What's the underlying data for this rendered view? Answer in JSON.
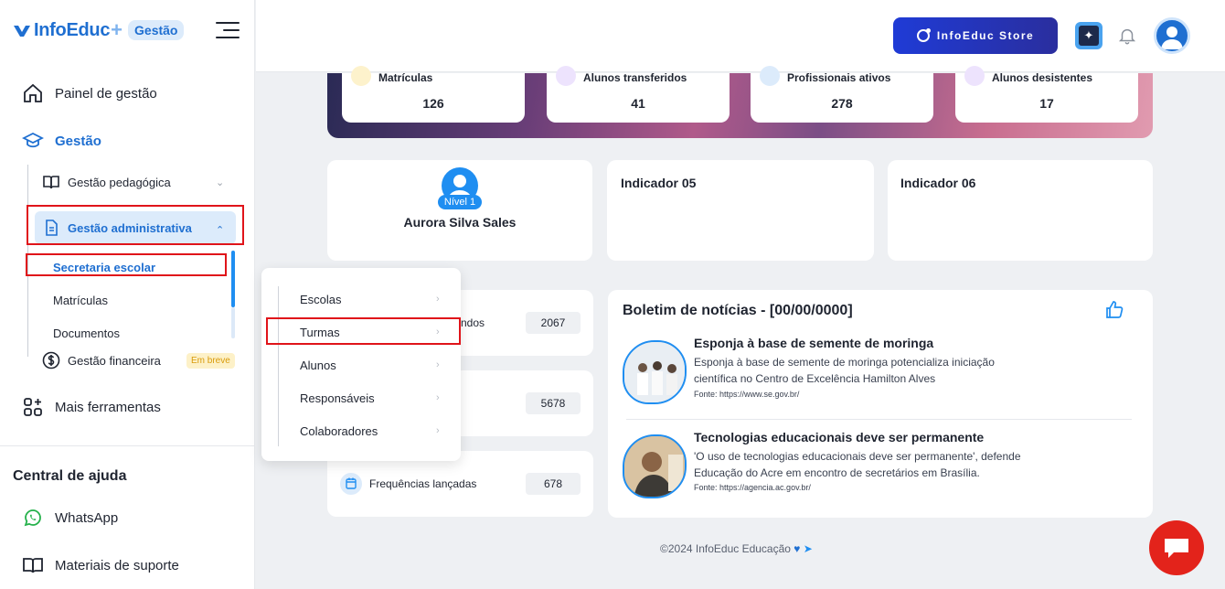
{
  "brand": {
    "name": "InfoEduc",
    "badge": "Gestão"
  },
  "sidebar": {
    "items": [
      {
        "label": "Painel de gestão"
      },
      {
        "label": "Gestão"
      },
      {
        "label": "Mais ferramentas"
      }
    ],
    "gestao_sub": {
      "pedagogica": "Gestão pedagógica",
      "administrativa": "Gestão administrativa",
      "financeira": "Gestão financeira",
      "financeira_badge": "Em breve"
    },
    "admin_sub": [
      "Secretaria escolar",
      "Matrículas",
      "Documentos"
    ],
    "help": {
      "title": "Central de ajuda",
      "items": [
        "WhatsApp",
        "Materiais de suporte"
      ]
    }
  },
  "topbar": {
    "store_label": "InfoEduc Store"
  },
  "stats": [
    {
      "label": "Matrículas",
      "value": "126",
      "color": "#f4c542"
    },
    {
      "label": "Alunos transferidos",
      "value": "41",
      "color": "#9b5cf6"
    },
    {
      "label": "Profissionais ativos",
      "value": "278",
      "color": "#1f8ef1"
    },
    {
      "label": "Alunos desistentes",
      "value": "17",
      "color": "#9b5cf6"
    }
  ],
  "profile": {
    "level": "Nível 1",
    "name": "Aurora Silva Sales"
  },
  "indicators": [
    "Indicador 05",
    "Indicador 06"
  ],
  "counters": [
    {
      "label_fragment": "ndos",
      "value": "2067"
    },
    {
      "label_fragment": "",
      "value": "5678"
    },
    {
      "label": "Frequências lançadas",
      "value": "678"
    }
  ],
  "news": {
    "title": "Boletim de notícias - [00/00/0000]",
    "items": [
      {
        "headline": "Esponja à base de semente de moringa",
        "desc": "Esponja à base de semente de moringa potencializa iniciação científica no Centro de Excelência Hamilton Alves",
        "source": "Fonte: https://www.se.gov.br/"
      },
      {
        "headline": "Tecnologias educacionais deve ser permanente",
        "desc": "'O uso de tecnologias educacionais deve ser permanente', defende Educação do Acre em encontro de secretários em Brasília.",
        "source": "Fonte: https://agencia.ac.gov.br/"
      }
    ]
  },
  "popup_menu": [
    "Escolas",
    "Turmas",
    "Alunos",
    "Responsáveis",
    "Colaboradores"
  ],
  "footer": "©2024 InfoEduc Educação"
}
